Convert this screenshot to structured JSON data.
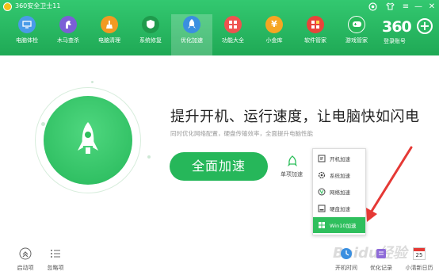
{
  "window": {
    "title": "360安全卫士11",
    "controls": [
      "skin-icon",
      "minimize-icon",
      "close-icon"
    ]
  },
  "nav": {
    "items": [
      {
        "label": "电脑体检",
        "icon": "monitor-icon",
        "color": "#4a9be8"
      },
      {
        "label": "木马查杀",
        "icon": "horse-icon",
        "color": "#7b5fd6"
      },
      {
        "label": "电脑清理",
        "icon": "broom-icon",
        "color": "#f29a22"
      },
      {
        "label": "系统修复",
        "icon": "shield-icon",
        "color": "#1f9a4c"
      },
      {
        "label": "优化加速",
        "icon": "rocket-icon",
        "color": "#3a8fe0"
      },
      {
        "label": "功能大全",
        "icon": "grid-icon",
        "color": "#ef5350"
      },
      {
        "label": "小金库",
        "icon": "coin-icon",
        "color": "#f5a623"
      },
      {
        "label": "软件管家",
        "icon": "apps-icon",
        "color": "#e8443a"
      },
      {
        "label": "游戏管家",
        "icon": "gamepad-icon",
        "color": "#27b85a"
      }
    ],
    "active_index": 4
  },
  "login": {
    "brand": "360",
    "label": "登录账号"
  },
  "main": {
    "headline": "提升开机、运行速度，让电脑快如闪电",
    "subline": "同时优化网络配置，硬盘传输效率，全面提升电脑性能",
    "primary_button": "全面加速",
    "single_label": "单项加速"
  },
  "dropdown": {
    "items": [
      {
        "label": "开机加速",
        "icon": "power-icon"
      },
      {
        "label": "系统加速",
        "icon": "gear-icon"
      },
      {
        "label": "网络加速",
        "icon": "network-icon"
      },
      {
        "label": "硬盘加速",
        "icon": "disk-icon"
      },
      {
        "label": "Win10加速",
        "icon": "windows-icon",
        "active": true
      }
    ]
  },
  "bottom": {
    "left": [
      {
        "label": "启动项",
        "icon": "startup-icon"
      },
      {
        "label": "忽略项",
        "icon": "list-icon"
      }
    ],
    "right": [
      {
        "label": "开机时间",
        "icon": "clock-icon"
      },
      {
        "label": "优化记录",
        "icon": "record-icon"
      },
      {
        "label": "小清新日历",
        "icon": "calendar-icon",
        "badge": "25"
      }
    ]
  },
  "watermark": "Baidu经验",
  "colors": {
    "brand_green": "#26b75a",
    "annotation_red": "#e53935"
  }
}
